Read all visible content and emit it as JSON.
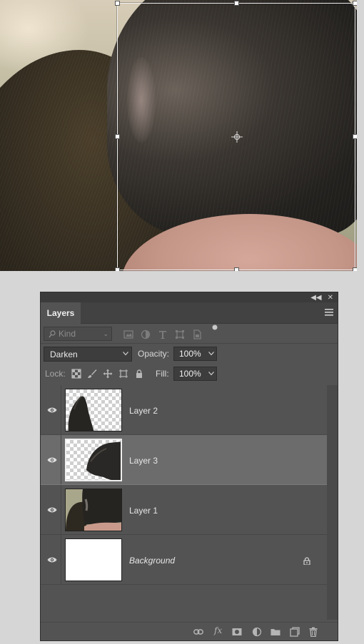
{
  "layers_panel": {
    "tab_label": "Layers",
    "kind_filter": {
      "value": "Kind"
    },
    "blend_mode": {
      "value": "Darken"
    },
    "opacity": {
      "label": "Opacity:",
      "value": "100%"
    },
    "lock": {
      "label": "Lock:"
    },
    "fill": {
      "label": "Fill:",
      "value": "100%"
    },
    "layers": [
      {
        "name": "Layer 2",
        "visible": true,
        "selected": false,
        "italic": false,
        "locked": false
      },
      {
        "name": "Layer 3",
        "visible": true,
        "selected": true,
        "italic": false,
        "locked": false
      },
      {
        "name": "Layer 1",
        "visible": true,
        "selected": false,
        "italic": false,
        "locked": false
      },
      {
        "name": "Background",
        "visible": true,
        "selected": false,
        "italic": true,
        "locked": true
      }
    ],
    "footer_icons": [
      "link-layers-icon",
      "fx-icon",
      "layer-mask-icon",
      "adjustment-layer-icon",
      "group-folder-icon",
      "new-layer-icon",
      "trash-icon"
    ]
  },
  "colors": {
    "panel_bg": "#535353",
    "selected_layer_bg": "#6c6c6c",
    "app_bg": "#d6d6d6"
  }
}
